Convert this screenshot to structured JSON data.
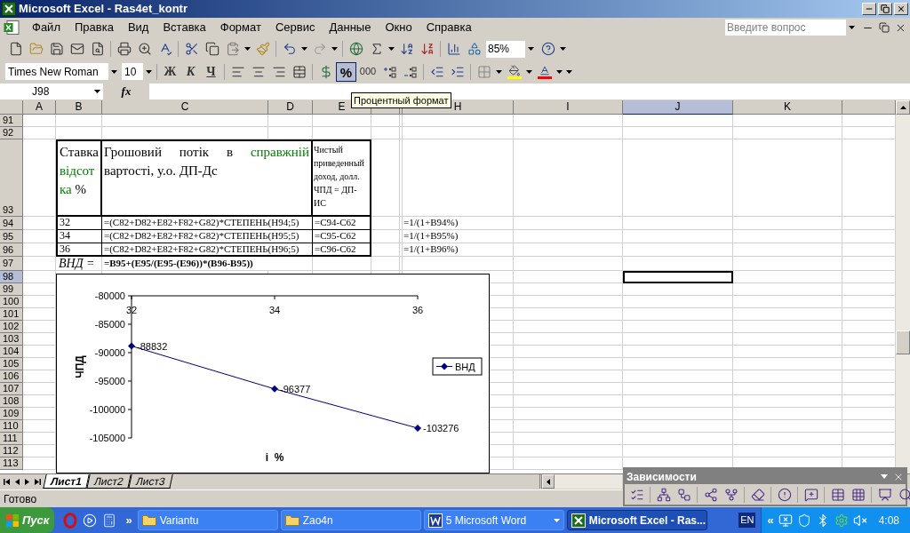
{
  "window": {
    "title": "Microsoft Excel - Ras4et_kontr"
  },
  "menu": [
    "Файл",
    "Правка",
    "Вид",
    "Вставка",
    "Формат",
    "Сервис",
    "Данные",
    "Окно",
    "Справка"
  ],
  "help_search": {
    "placeholder": "Введите вопрос"
  },
  "standard_toolbar": {
    "zoom": "85%"
  },
  "formatting_toolbar": {
    "font": "Times New Roman",
    "size": "10",
    "style_buttons": [
      "Ж",
      "К",
      "Ч"
    ],
    "percent": {
      "label": "%",
      "selected": true
    },
    "thousands": "000"
  },
  "tooltip": "Процентный формат",
  "formula_bar": {
    "name_box": "J98",
    "fx": "fx"
  },
  "columns": [
    {
      "label": "A",
      "selected": false
    },
    {
      "label": "B",
      "selected": false
    },
    {
      "label": "C",
      "selected": false
    },
    {
      "label": "D",
      "selected": false
    },
    {
      "label": "E",
      "selected": false
    },
    {
      "selected": false
    },
    {
      "selected": false
    },
    {
      "label": "H",
      "selected": false
    },
    {
      "label": "I",
      "selected": false
    },
    {
      "label": "J",
      "selected": true
    },
    {
      "label": "K",
      "selected": false
    },
    {
      "selected": false
    }
  ],
  "rows": [
    {
      "number": "91",
      "kind": "plain",
      "selected": false
    },
    {
      "number": "92",
      "kind": "plain",
      "selected": false
    },
    {
      "number": "93",
      "kind": "header",
      "selected": false,
      "b": [
        {
          "text": "Ставка ",
          "kind": "plain"
        },
        {
          "text": "відсотка",
          "kind": "green"
        },
        {
          "text": " %",
          "kind": "plain"
        }
      ],
      "c": [
        {
          "text": "Грошовий потік в ",
          "kind": "plain"
        },
        {
          "text": "справжній",
          "kind": "green"
        },
        {
          "text": " вартості, у.о. ДП-Дс",
          "kind": "plain"
        }
      ],
      "e": "Чистый приведенный доход, долл. ЧПД = ДП-ИС"
    },
    {
      "number": "94",
      "kind": "data",
      "selected": false,
      "b": "32",
      "c": "=(C82+D82+E82+F82+G82)*СТЕПЕНЬ(H94;5)",
      "e": "=C94-C62",
      "h": "=1/(1+B94%)"
    },
    {
      "number": "95",
      "kind": "data",
      "selected": false,
      "b": "34",
      "c": "=(C82+D82+E82+F82+G82)*СТЕПЕНЬ(H95;5)",
      "e": "=C95-C62",
      "h": "=1/(1+B95%)"
    },
    {
      "number": "96",
      "kind": "data",
      "selected": false,
      "b": "36",
      "c": "=(C82+D82+E82+F82+G82)*СТЕПЕНЬ(H96;5)",
      "e": "=C96-C62",
      "h": "=1/(1+B96%)"
    },
    {
      "number": "97",
      "kind": "result",
      "selected": false,
      "b": "ВНД =",
      "c": "=B95+(E95/(E95-(E96))*(B96-B95))"
    },
    {
      "number": "98",
      "kind": "plain",
      "selected": true
    },
    {
      "number": "99",
      "kind": "plain",
      "selected": false
    },
    {
      "number": "100",
      "kind": "plain",
      "selected": false
    },
    {
      "number": "101",
      "kind": "plain",
      "selected": false
    },
    {
      "number": "102",
      "kind": "plain",
      "selected": false
    },
    {
      "number": "103",
      "kind": "plain",
      "selected": false
    },
    {
      "number": "104",
      "kind": "plain",
      "selected": false
    },
    {
      "number": "105",
      "kind": "plain",
      "selected": false
    },
    {
      "number": "106",
      "kind": "plain",
      "selected": false
    },
    {
      "number": "107",
      "kind": "plain",
      "selected": false
    },
    {
      "number": "108",
      "kind": "plain",
      "selected": false
    },
    {
      "number": "109",
      "kind": "plain",
      "selected": false
    },
    {
      "number": "110",
      "kind": "plain",
      "selected": false
    },
    {
      "number": "111",
      "kind": "plain",
      "selected": false
    },
    {
      "number": "112",
      "kind": "plain",
      "selected": false
    },
    {
      "number": "113",
      "kind": "plain",
      "selected": false
    }
  ],
  "chart": {
    "chart_data": {
      "type": "line",
      "xlabel": "i  %",
      "ylabel": "ЧПД",
      "categories": [
        "32",
        "34",
        "36"
      ],
      "series": [
        {
          "name": "ВНД",
          "color": "#000080",
          "marker": "diamond",
          "values": [
            -88832,
            -96377,
            -103276
          ]
        }
      ],
      "ylim": [
        -105000,
        -80000
      ],
      "yticks": [
        -80000,
        -85000,
        -90000,
        -95000,
        -100000,
        -105000
      ],
      "data_labels": true
    }
  },
  "sheet_tabs": [
    {
      "label": "Лист1",
      "selected": true
    },
    {
      "label": "Лист2",
      "selected": false
    },
    {
      "label": "Лист3",
      "selected": false
    }
  ],
  "dependencies_toolbar": {
    "title": "Зависимости"
  },
  "status_bar": "Готово",
  "taskbar": {
    "start": "Пуск",
    "chevron": "»",
    "buttons": [
      {
        "label": "Variantu",
        "kind": "folder",
        "selected": false
      },
      {
        "label": "Zao4n",
        "kind": "folder",
        "selected": false
      },
      {
        "label": "5 Microsoft Word",
        "kind": "word",
        "selected": false
      },
      {
        "label": "Microsoft Excel - Ras...",
        "kind": "excel",
        "selected": true
      }
    ],
    "language": "EN",
    "tray_toggle": "«",
    "clock": "4:08"
  }
}
